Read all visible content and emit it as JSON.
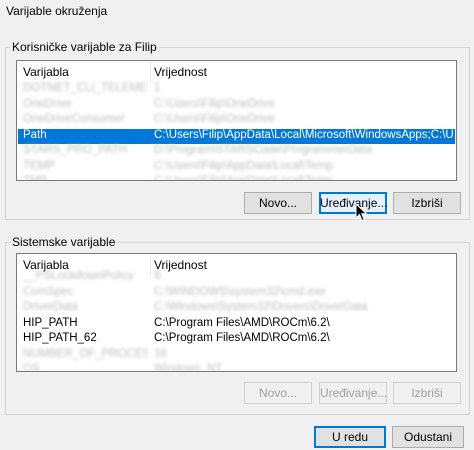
{
  "window": {
    "title": "Varijable okruženja"
  },
  "user_section": {
    "legend": "Korisničke varijable za Filip",
    "columns": [
      "Varijabla",
      "Vrijednost"
    ],
    "rows": [
      {
        "name": "DOTNET_CLI_TELEMETRY_O...",
        "value": "1",
        "obscured": true
      },
      {
        "name": "OneDrive",
        "value": "C:\\Users\\Filip\\OneDrive",
        "obscured": true
      },
      {
        "name": "OneDriveConsumer",
        "value": "C:\\Users\\Filip\\OneDrive",
        "obscured": true
      },
      {
        "name": "Path",
        "value": "C:\\Users\\Filip\\AppData\\Local\\Microsoft\\WindowsApps;C:\\Users\\Filip\\",
        "obscured": false,
        "selected": true
      },
      {
        "name": "STARS_PRO_PATH",
        "value": "D:\\Program\\STARSCode\\ProgrammerData",
        "obscured": true
      },
      {
        "name": "TEMP",
        "value": "C:\\Users\\Filip\\AppData\\Local\\Temp",
        "obscured": true
      },
      {
        "name": "TMP",
        "value": "C:\\Users\\Filip\\AppData\\Local\\Temp",
        "obscured": true
      }
    ],
    "buttons": {
      "new": "Novo...",
      "edit": "Uređivanje...",
      "delete": "Izbriši"
    }
  },
  "system_section": {
    "legend": "Sistemske varijable",
    "columns": [
      "Varijabla",
      "Vrijednost"
    ],
    "rows": [
      {
        "name": "__PSLockdownPolicy",
        "value": "8",
        "obscured": true
      },
      {
        "name": "ComSpec",
        "value": "C:\\WINDOWS\\system32\\cmd.exe",
        "obscured": true
      },
      {
        "name": "DriverData",
        "value": "C:\\Windows\\System32\\Drivers\\DriverData",
        "obscured": true
      },
      {
        "name": "HIP_PATH",
        "value": "C:\\Program Files\\AMD\\ROCm\\6.2\\",
        "obscured": false
      },
      {
        "name": "HIP_PATH_62",
        "value": "C:\\Program Files\\AMD\\ROCm\\6.2\\",
        "obscured": false
      },
      {
        "name": "NUMBER_OF_PROCESSORS",
        "value": "16",
        "obscured": true
      },
      {
        "name": "OS",
        "value": "Windows_NT",
        "obscured": true
      }
    ],
    "buttons": {
      "new": "Novo...",
      "edit": "Uređivanje...",
      "delete": "Izbriši"
    }
  },
  "footer": {
    "ok": "U redu",
    "cancel": "Odustani"
  },
  "colors": {
    "selection": "#0078d7",
    "background": "#f0f0f0"
  }
}
